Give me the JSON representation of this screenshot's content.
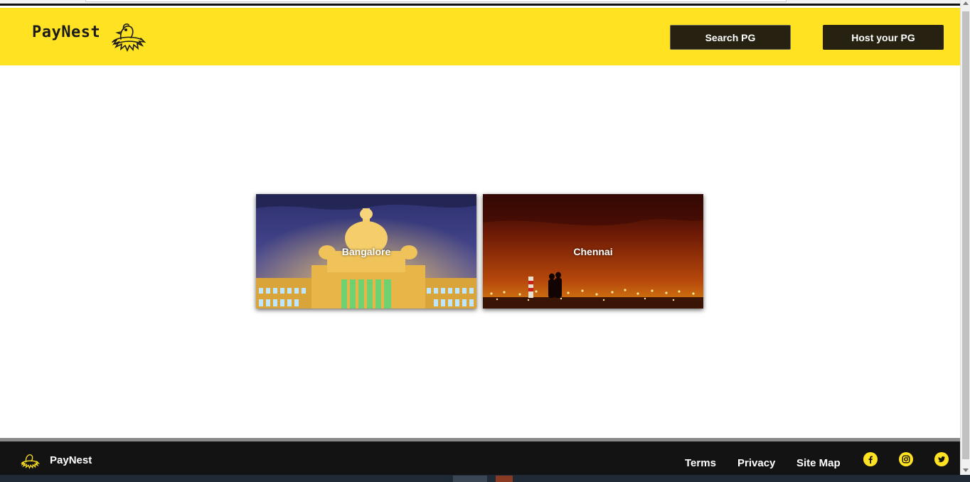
{
  "header": {
    "brand": "PayNest",
    "search_button": "Search PG",
    "host_button": "Host your PG"
  },
  "cities": [
    {
      "label": "Bangalore"
    },
    {
      "label": "Chennai"
    }
  ],
  "footer": {
    "brand": "PayNest",
    "links": [
      "Terms",
      "Privacy",
      "Site Map"
    ],
    "social": [
      "facebook-icon",
      "instagram-icon",
      "twitter-icon"
    ]
  },
  "colors": {
    "accent": "#ffe222",
    "button": "#262111",
    "footer": "#131313"
  }
}
